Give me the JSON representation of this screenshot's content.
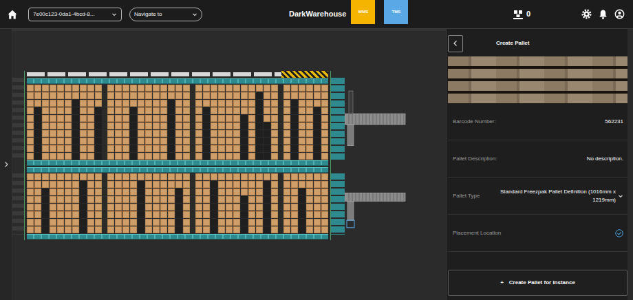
{
  "header": {
    "workspace": "7e00c123-0da1-4bcd-8...",
    "navigate": "Navigate to",
    "brand": "DarkWarehouse",
    "apps": [
      {
        "label": "WMS",
        "color": "#f5b400"
      },
      {
        "label": "TMS",
        "color": "#5aa9e6"
      }
    ],
    "pallet_count": "0"
  },
  "map": {
    "sections": [
      {
        "capacity": 10,
        "blocks": [
          [
            10,
            3,
            10,
            10,
            10,
            10,
            2,
            10,
            10,
            3
          ],
          [
            10,
            10,
            10,
            3,
            10,
            10,
            10,
            10,
            2,
            10,
            10
          ],
          [
            10,
            3,
            10,
            10,
            10,
            10,
            4,
            10,
            1,
            5,
            10
          ],
          [
            10,
            2,
            10,
            10,
            3,
            10
          ]
        ]
      },
      {
        "capacity": 8,
        "blocks": [
          [
            8,
            8,
            2,
            8,
            8,
            8,
            8,
            1,
            8,
            8
          ],
          [
            8,
            8,
            8,
            8,
            1,
            8,
            8,
            8,
            8,
            2,
            8
          ],
          [
            8,
            8,
            1,
            8,
            8,
            8,
            3,
            8,
            8,
            1,
            8
          ],
          [
            8,
            8,
            2,
            8,
            8,
            8
          ]
        ]
      }
    ]
  },
  "panel": {
    "title": "Create Pallet",
    "fields": [
      {
        "label": "Barcode Number:",
        "value": "562231",
        "kind": "text"
      },
      {
        "label": "Pallet Description:",
        "value": "No description.",
        "kind": "text"
      },
      {
        "label": "Pallet Type",
        "value": "Standard Freezpak Pallet Definition (1016mm x 1219mm)",
        "kind": "select"
      },
      {
        "label": "Placement Location",
        "kind": "check",
        "checked": true
      }
    ],
    "button": {
      "icon": "+",
      "label": "Create Pallet for Instance"
    }
  }
}
